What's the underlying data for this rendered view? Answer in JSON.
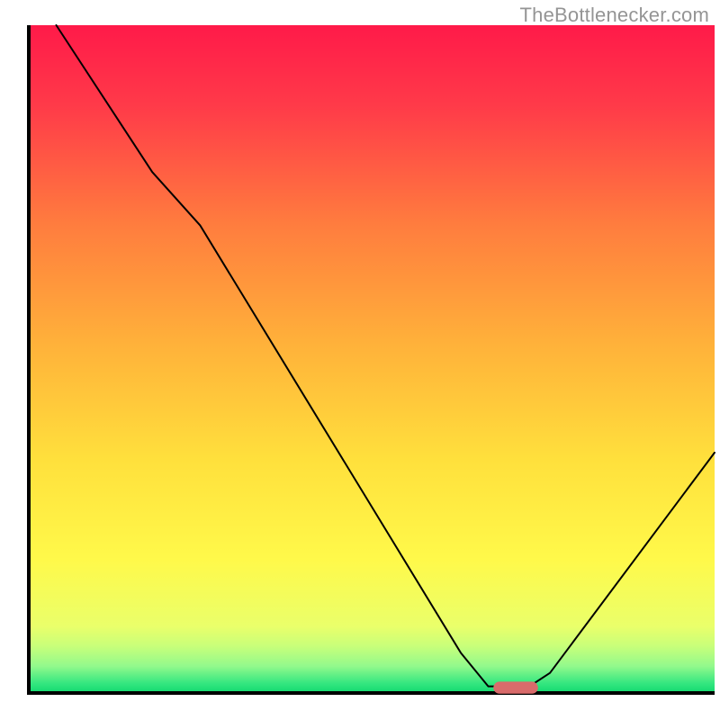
{
  "watermark": {
    "text": "TheBottlenecker.com",
    "position_css": "top:4px; right:12px;"
  },
  "chart_data": {
    "type": "line",
    "title": "",
    "xlabel": "",
    "ylabel": "",
    "xlim": [
      0,
      100
    ],
    "ylim": [
      0,
      100
    ],
    "grid": false,
    "background": {
      "type": "vertical-gradient",
      "description": "red at top through orange/yellow to green band at bottom",
      "stops": [
        {
          "offset": 0.0,
          "color": "#ff1a49"
        },
        {
          "offset": 0.12,
          "color": "#ff3a49"
        },
        {
          "offset": 0.3,
          "color": "#ff7d3e"
        },
        {
          "offset": 0.48,
          "color": "#ffb23a"
        },
        {
          "offset": 0.65,
          "color": "#ffe03c"
        },
        {
          "offset": 0.8,
          "color": "#fff94a"
        },
        {
          "offset": 0.9,
          "color": "#eaff6a"
        },
        {
          "offset": 0.93,
          "color": "#c8ff7a"
        },
        {
          "offset": 0.96,
          "color": "#92f98c"
        },
        {
          "offset": 0.985,
          "color": "#36e780"
        },
        {
          "offset": 1.0,
          "color": "#10d96f"
        }
      ]
    },
    "series": [
      {
        "name": "bottleneck-curve",
        "color": "#000000",
        "stroke_width": 2,
        "points": [
          {
            "x": 4,
            "y": 100
          },
          {
            "x": 18,
            "y": 78
          },
          {
            "x": 25,
            "y": 70
          },
          {
            "x": 63,
            "y": 6
          },
          {
            "x": 67,
            "y": 1
          },
          {
            "x": 73,
            "y": 1
          },
          {
            "x": 76,
            "y": 3
          },
          {
            "x": 100,
            "y": 36
          }
        ]
      }
    ],
    "marker": {
      "name": "optimal-range",
      "shape": "rounded-rect",
      "color": "#d96b6b",
      "x_center": 71,
      "y_center": 0.8,
      "width": 6.5,
      "height": 1.8
    },
    "axes": {
      "stroke": "#000000",
      "stroke_width": 4,
      "show_ticks": false
    }
  }
}
